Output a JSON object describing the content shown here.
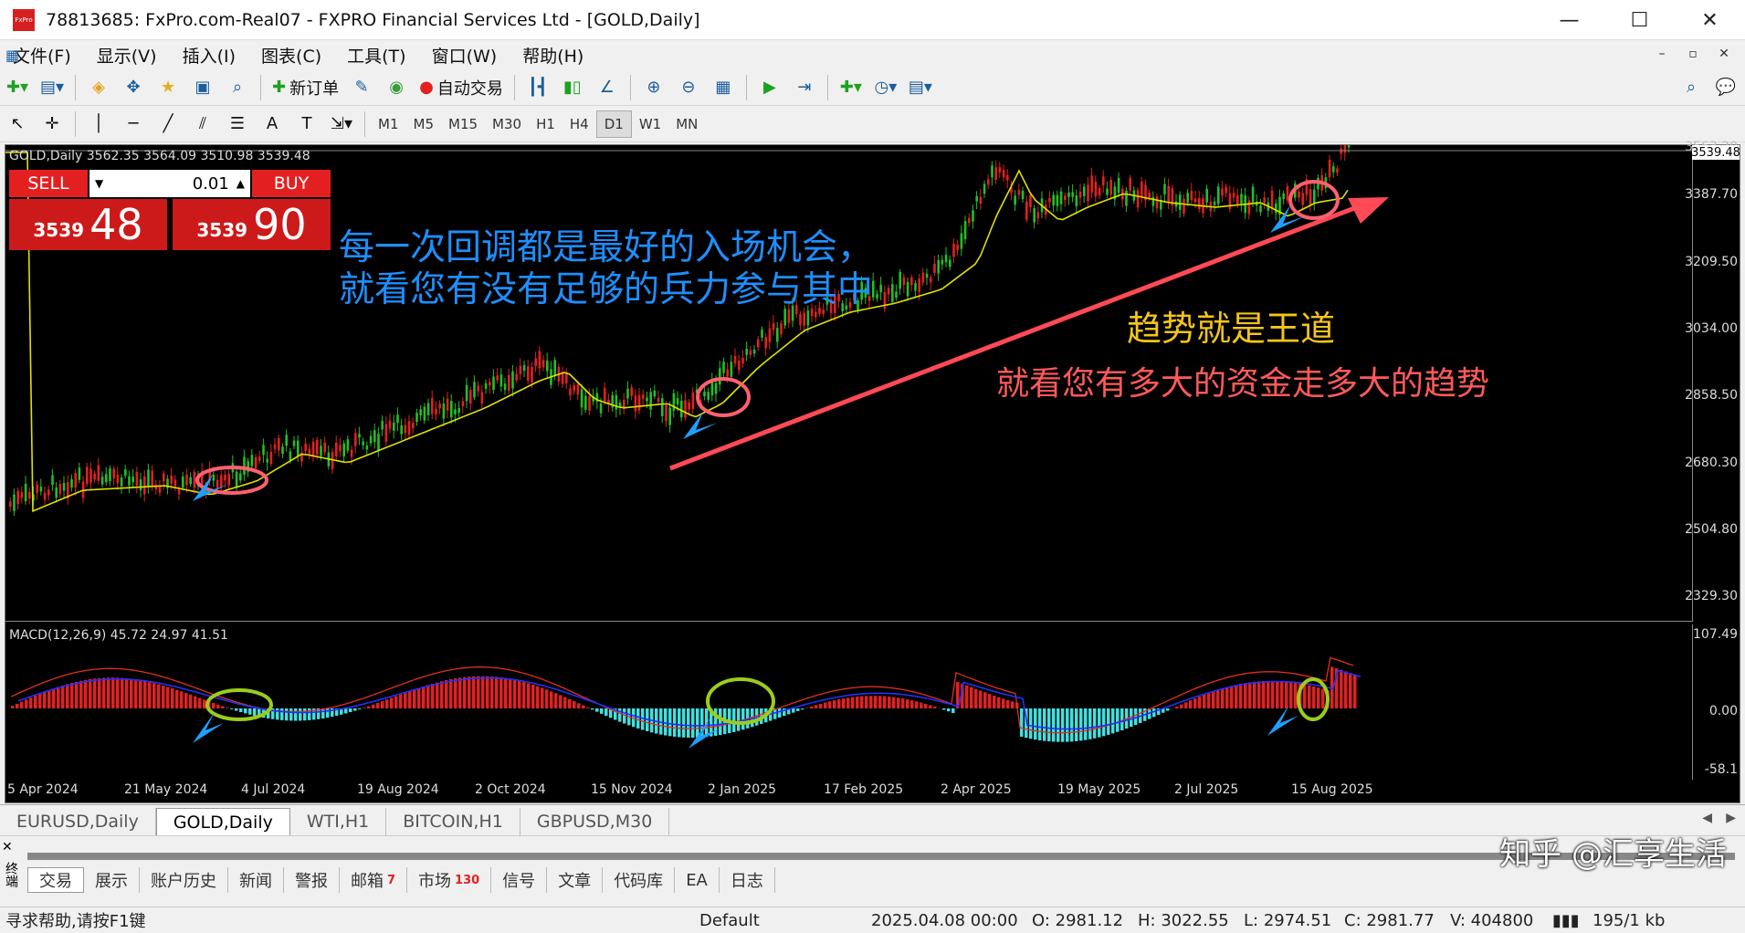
{
  "window": {
    "title": "78813685: FxPro.com-Real07 - FXPRO Financial Services Ltd - [GOLD,Daily]",
    "app_icon_text": "FxPro",
    "minimize": "—",
    "maximize": "☐",
    "close": "✕"
  },
  "menu": [
    "文件(F)",
    "显示(V)",
    "插入(I)",
    "图表(C)",
    "工具(T)",
    "窗口(W)",
    "帮助(H)"
  ],
  "toolbar": {
    "new_order": "新订单",
    "auto_trade": "自动交易"
  },
  "timeframes": [
    "M1",
    "M5",
    "M15",
    "M30",
    "H1",
    "H4",
    "D1",
    "W1",
    "MN"
  ],
  "active_timeframe": "D1",
  "chart": {
    "header": "GOLD,Daily  3562.35 3564.09 3510.98 3539.48",
    "sell_label": "SELL",
    "buy_label": "BUY",
    "lot": "0.01",
    "sell_small": "3539",
    "sell_big": "48",
    "buy_small": "3539",
    "buy_big": "90",
    "current_price": "3539.48",
    "price_axis": [
      "3387.70",
      "3209.50",
      "3034.00",
      "2858.50",
      "2680.30",
      "2504.80",
      "2329.30"
    ],
    "top_partial": "3563.20",
    "macd_header": "MACD(12,26,9) 45.72 24.97 41.51",
    "macd_axis": [
      "107.49",
      "0.00",
      "-58.1"
    ],
    "dates": [
      "5 Apr 2024",
      "21 May 2024",
      "4 Jul 2024",
      "19 Aug 2024",
      "2 Oct 2024",
      "15 Nov 2024",
      "2 Jan 2025",
      "17 Feb 2025",
      "2 Apr 2025",
      "19 May 2025",
      "2 Jul 2025",
      "15 Aug 2025"
    ],
    "annotation_1a": "每一次回调都是最好的入场机会，",
    "annotation_1b": "就看您有没有足够的兵力参与其中",
    "annotation_2": "趋势就是王道",
    "annotation_3": "就看您有多大的资金走多大的趋势"
  },
  "chart_tabs": [
    "EURUSD,Daily",
    "GOLD,Daily",
    "WTI,H1",
    "BITCOIN,H1",
    "GBPUSD,M30"
  ],
  "active_chart_tab": "GOLD,Daily",
  "terminal": {
    "close": "✕",
    "side_label": "终端",
    "tabs": [
      {
        "label": "交易",
        "count": ""
      },
      {
        "label": "展示",
        "count": ""
      },
      {
        "label": "账户历史",
        "count": ""
      },
      {
        "label": "新闻",
        "count": ""
      },
      {
        "label": "警报",
        "count": ""
      },
      {
        "label": "邮箱",
        "count": "7"
      },
      {
        "label": "市场",
        "count": "130"
      },
      {
        "label": "信号",
        "count": ""
      },
      {
        "label": "文章",
        "count": ""
      },
      {
        "label": "代码库",
        "count": ""
      },
      {
        "label": "EA",
        "count": ""
      },
      {
        "label": "日志",
        "count": ""
      }
    ]
  },
  "status": {
    "help": "寻求帮助,请按F1键",
    "profile": "Default",
    "datetime": "2025.04.08 00:00",
    "open": "O: 2981.12",
    "high": "H: 3022.55",
    "low": "L: 2974.51",
    "close": "C: 2981.77",
    "volume": "V: 404800",
    "traffic": "195/1 kb"
  },
  "watermark": "知乎 @汇享生活",
  "colors": {
    "bull": "#e32020",
    "bear": "#22c022",
    "ma": "#e0e000",
    "macd_pos": "#e32020",
    "macd_neg": "#40e0e0",
    "signal_blue": "#2030ff",
    "macd_red": "#e03020",
    "annotation_blue": "#1e8fff",
    "annotation_yellow": "#f5c518",
    "annotation_red": "#ff5a5a",
    "arrow": "#ff4a55",
    "pointer": "#1ea0ff",
    "circle_green": "#9ccd1a",
    "circle_pink": "#ff6070"
  }
}
